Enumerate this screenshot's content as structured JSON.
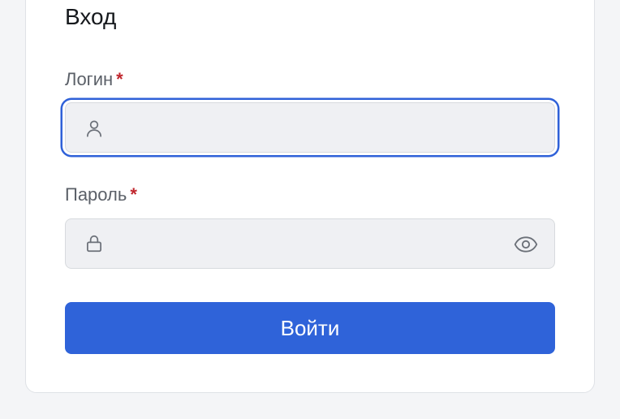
{
  "form": {
    "title": "Вход",
    "login": {
      "label": "Логин",
      "required_mark": "*",
      "value": "",
      "placeholder": "",
      "icon": "user-icon",
      "focused": true
    },
    "password": {
      "label": "Пароль",
      "required_mark": "*",
      "value": "",
      "placeholder": "",
      "icon": "lock-icon",
      "toggle_icon": "eye-icon"
    },
    "submit_label": "Войти"
  },
  "colors": {
    "accent": "#2f63d9",
    "focus_ring": "#2f61d8",
    "required": "#c0262d",
    "background": "#f4f5f7",
    "field_background": "#eff0f3"
  }
}
